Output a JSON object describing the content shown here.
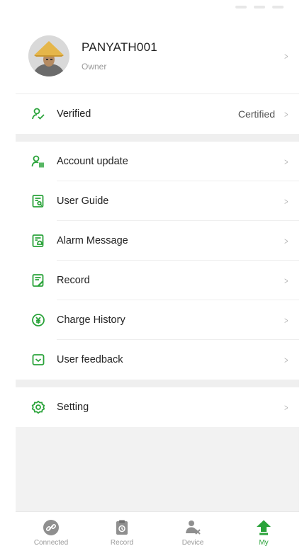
{
  "profile": {
    "name": "PANYATH001",
    "role": "Owner"
  },
  "verified": {
    "label": "Verified",
    "value": "Certified"
  },
  "menu": [
    {
      "label": "Account update",
      "icon": "account-update-icon"
    },
    {
      "label": "User Guide",
      "icon": "user-guide-icon"
    },
    {
      "label": "Alarm Message",
      "icon": "alarm-message-icon"
    },
    {
      "label": "Record",
      "icon": "record-icon"
    },
    {
      "label": "Charge History",
      "icon": "charge-history-icon"
    },
    {
      "label": "User feedback",
      "icon": "user-feedback-icon"
    }
  ],
  "setting": {
    "label": "Setting",
    "icon": "gear-icon"
  },
  "tabs": [
    {
      "label": "Connected",
      "icon": "link-icon"
    },
    {
      "label": "Record",
      "icon": "clipboard-icon"
    },
    {
      "label": "Device",
      "icon": "device-icon"
    },
    {
      "label": "My",
      "icon": "my-arrow-icon",
      "active": true
    }
  ],
  "colors": {
    "accent": "#2aa33a",
    "chevron": "#b5b5b5",
    "background": "#f2f2f2"
  }
}
